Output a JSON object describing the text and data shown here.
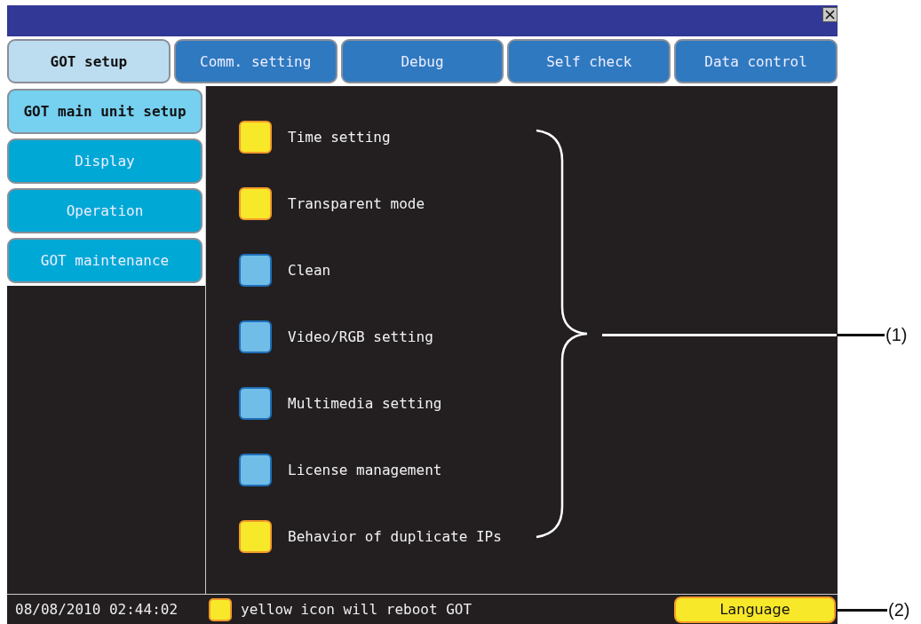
{
  "tabs": [
    {
      "label": "GOT setup",
      "selected": true
    },
    {
      "label": "Comm. setting",
      "selected": false
    },
    {
      "label": "Debug",
      "selected": false
    },
    {
      "label": "Self check",
      "selected": false
    },
    {
      "label": "Data control",
      "selected": false
    }
  ],
  "side_menu": [
    {
      "label": "GOT main unit setup",
      "selected": true
    },
    {
      "label": "Display",
      "selected": false
    },
    {
      "label": "Operation",
      "selected": false
    },
    {
      "label": "GOT maintenance",
      "selected": false
    }
  ],
  "settings": [
    {
      "label": "Time setting",
      "kind": "reboot"
    },
    {
      "label": "Transparent mode",
      "kind": "reboot"
    },
    {
      "label": "Clean",
      "kind": "normal"
    },
    {
      "label": "Video/RGB setting",
      "kind": "normal"
    },
    {
      "label": "Multimedia setting",
      "kind": "normal"
    },
    {
      "label": "License management",
      "kind": "normal"
    },
    {
      "label": "Behavior of duplicate IPs",
      "kind": "reboot"
    }
  ],
  "status_bar": {
    "datetime": "08/08/2010 02:44:02",
    "legend": {
      "kind": "reboot",
      "text": "yellow icon will reboot GOT"
    },
    "language_button": "Language"
  },
  "annotations": [
    "(1)",
    "(2)"
  ]
}
